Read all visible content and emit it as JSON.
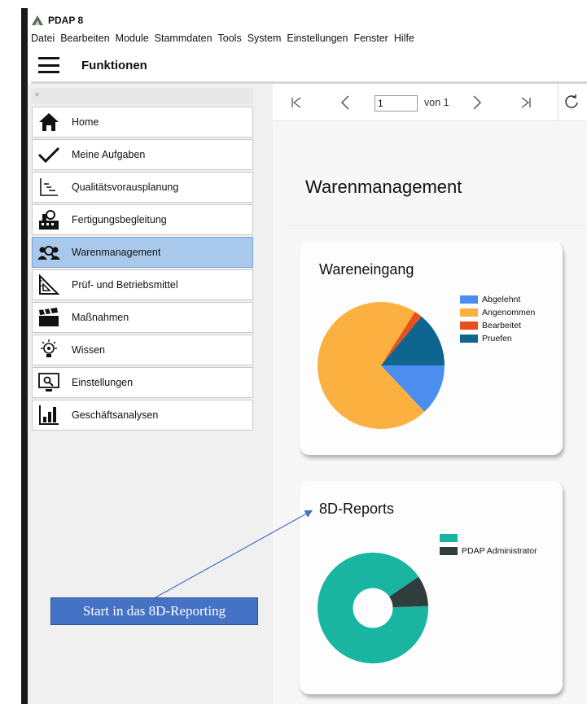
{
  "app": {
    "title": "PDAP 8",
    "logo_icon": "pdap-logo-icon"
  },
  "menu": [
    "Datei",
    "Bearbeiten",
    "Module",
    "Stammdaten",
    "Tools",
    "System",
    "Einstellungen",
    "Fenster",
    "Hilfe"
  ],
  "functions_bar": {
    "title": "Funktionen",
    "menu_icon": "hamburger-icon"
  },
  "sidebar": {
    "collapse_glyph": "»",
    "items": [
      {
        "label": "Home",
        "icon": "home-icon",
        "active": false
      },
      {
        "label": "Meine Aufgaben",
        "icon": "checkmark-icon",
        "active": false
      },
      {
        "label": "Qualitätsvorausplanung",
        "icon": "chart-steps-icon",
        "active": false
      },
      {
        "label": "Fertigungsbegleitung",
        "icon": "factory-icon",
        "active": false
      },
      {
        "label": "Warenmanagement",
        "icon": "people-search-icon",
        "active": true
      },
      {
        "label": "Prüf- und Betriebsmittel",
        "icon": "triangle-ruler-icon",
        "active": false
      },
      {
        "label": "Maßnahmen",
        "icon": "clapperboard-icon",
        "active": false
      },
      {
        "label": "Wissen",
        "icon": "lightbulb-icon",
        "active": false
      },
      {
        "label": "Einstellungen",
        "icon": "settings-monitor-icon",
        "active": false
      },
      {
        "label": "Geschäftsanalysen",
        "icon": "bar-chart-icon",
        "active": false
      }
    ]
  },
  "pager": {
    "current_page": "1",
    "of_label": "von 1"
  },
  "content": {
    "title": "Warenmanagement"
  },
  "wareneingang": {
    "title": "Wareneingang",
    "legend": [
      {
        "label": "Abgelehnt",
        "color": "#4b8ef0"
      },
      {
        "label": "Angenommen",
        "color": "#fbb040"
      },
      {
        "label": "Bearbeitet",
        "color": "#e8501a"
      },
      {
        "label": "Pruefen",
        "color": "#0e6690"
      }
    ]
  },
  "reports8d": {
    "title": "8D-Reports",
    "legend": [
      {
        "label": "",
        "color": "#1ab5a0"
      },
      {
        "label": "PDAP Administrator",
        "color": "#2f3d3d"
      }
    ]
  },
  "annotation": {
    "text": "Start in das 8D-Reporting"
  },
  "chart_data": [
    {
      "type": "pie",
      "title": "Wareneingang",
      "categories": [
        "Abgelehnt",
        "Angenommen",
        "Bearbeitet",
        "Pruefen"
      ],
      "values": [
        13,
        71,
        2,
        14
      ],
      "colors": [
        "#4b8ef0",
        "#fbb040",
        "#e8501a",
        "#0e6690"
      ],
      "legend": "right"
    },
    {
      "type": "pie",
      "title": "8D-Reports",
      "categories": [
        "",
        "PDAP Administrator"
      ],
      "values": [
        91,
        9
      ],
      "colors": [
        "#1ab5a0",
        "#2f3d3d"
      ],
      "donut": true,
      "legend": "right"
    }
  ]
}
